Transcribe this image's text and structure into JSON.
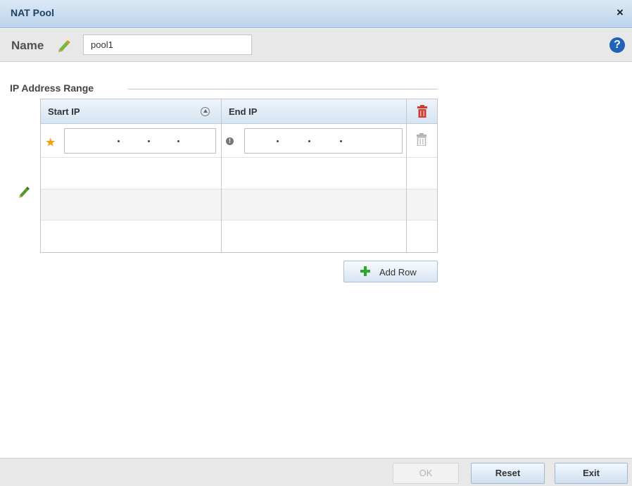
{
  "dialog": {
    "title": "NAT Pool",
    "close_glyph": "×"
  },
  "name_field": {
    "label": "Name",
    "value": "pool1",
    "help_glyph": "?"
  },
  "section": {
    "title": "IP Address Range"
  },
  "table": {
    "columns": [
      "Start IP",
      "End IP"
    ],
    "rows": [
      {
        "start_ip": "",
        "end_ip": ""
      }
    ]
  },
  "add_row_label": "Add Row",
  "footer": {
    "ok_label": "OK",
    "reset_label": "Reset",
    "exit_label": "Exit"
  },
  "colors": {
    "titlebar": "#bcd3ea",
    "accent_help": "#1e63b8",
    "delete_red": "#d13a2e",
    "required_star": "#f0a014",
    "add_green": "#2ea52e"
  },
  "icons": [
    "close-icon",
    "pencil-icon",
    "help-icon",
    "sort-icon",
    "trash-icon",
    "required-star-icon",
    "info-icon",
    "plus-icon",
    "edit-row-icon"
  ]
}
